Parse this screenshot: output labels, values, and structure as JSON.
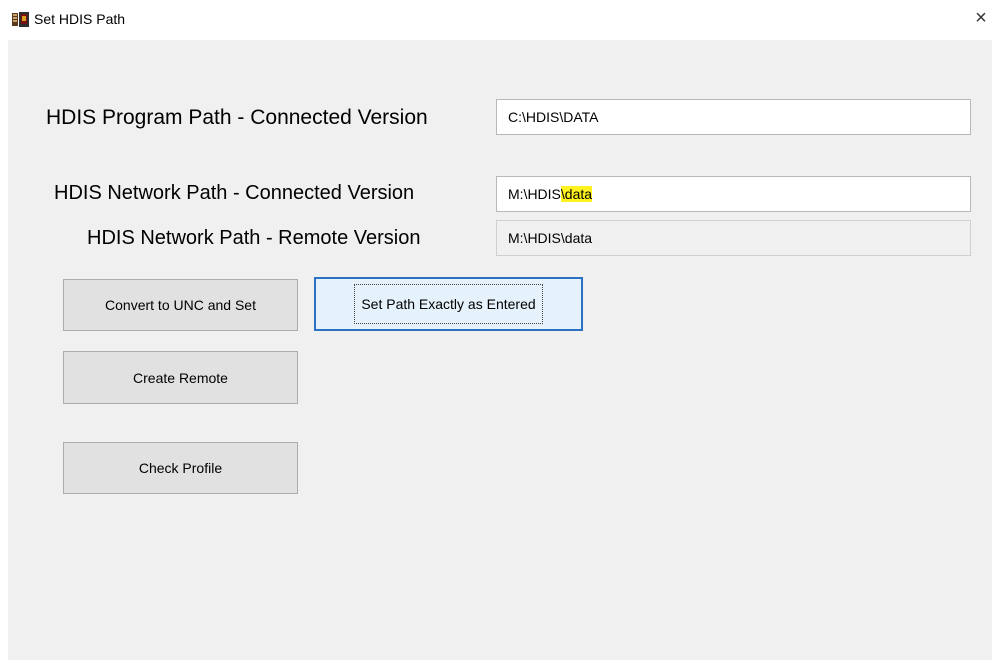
{
  "window": {
    "title": "Set HDIS Path",
    "close_glyph": "×"
  },
  "form": {
    "program_connected_label": "HDIS Program Path - Connected Version",
    "program_connected_value": "C:\\HDIS\\DATA",
    "network_connected_label": "HDIS Network Path - Connected Version",
    "network_connected_value_prefix": "M:\\HDIS",
    "network_connected_value_highlight": "\\data",
    "network_remote_label": "HDIS Network Path - Remote Version",
    "network_remote_value": "M:\\HDIS\\data"
  },
  "buttons": {
    "convert_unc": "Convert to UNC and Set",
    "set_exact": "Set Path Exactly as Entered",
    "create_remote": "Create Remote",
    "check_profile": "Check Profile"
  },
  "colors": {
    "highlight": "#fff21e",
    "focus_border": "#2a73c4",
    "dialog_bg": "#f0f0f0"
  },
  "icons": {
    "app_icon": "hdis-app-icon",
    "close_icon": "close-icon"
  }
}
